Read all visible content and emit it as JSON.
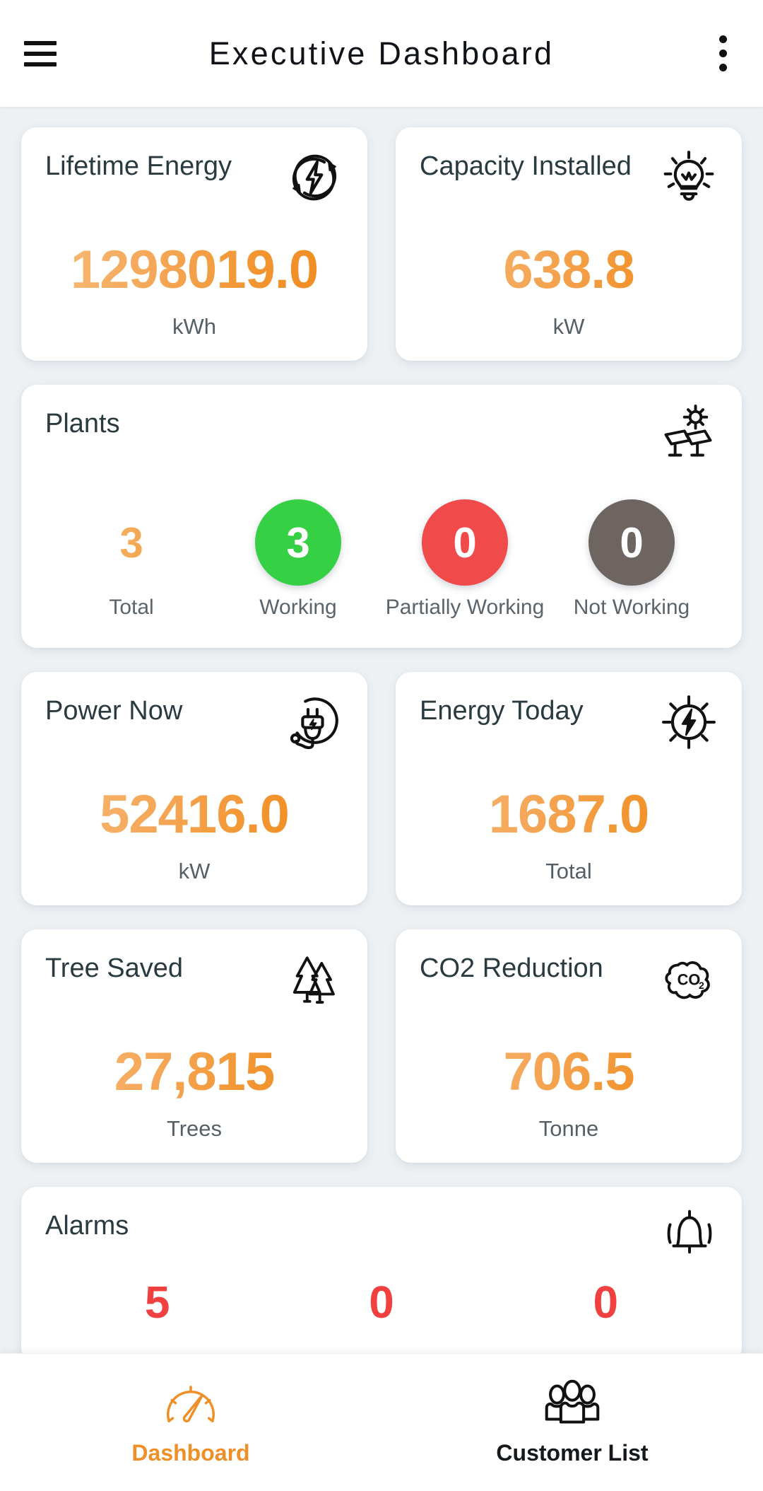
{
  "header": {
    "title": "Executive Dashboard",
    "menu_icon": "hamburger-menu-icon",
    "overflow_icon": "kebab-menu-icon"
  },
  "colors": {
    "background": "#edf1f4",
    "card": "#ffffff",
    "accent_orange": "#ef8f28",
    "value_gradient_start": "#f6bb76",
    "value_gradient_end": "#f08a1c",
    "title_text": "#2a3a41",
    "unit_text": "#555f66",
    "status_working": "#35d043",
    "status_partial": "#f04a4a",
    "status_not_working": "#6e6460",
    "alarm_red": "#f04040"
  },
  "cards": {
    "lifetime_energy": {
      "title": "Lifetime Energy",
      "value": "1298019.0",
      "unit": "kWh",
      "icon": "energy-bolt-cycle-icon"
    },
    "capacity_installed": {
      "title": "Capacity Installed",
      "value": "638.8",
      "unit": "kW",
      "icon": "lightbulb-icon"
    },
    "plants": {
      "title": "Plants",
      "icon": "solar-panel-sun-icon",
      "stats": [
        {
          "value": "3",
          "label": "Total",
          "style": "plain"
        },
        {
          "value": "3",
          "label": "Working",
          "style": "green"
        },
        {
          "value": "0",
          "label": "Partially Working",
          "style": "red"
        },
        {
          "value": "0",
          "label": "Not Working",
          "style": "gray"
        }
      ]
    },
    "power_now": {
      "title": "Power Now",
      "value": "52416.0",
      "unit": "kW",
      "icon": "power-plug-icon"
    },
    "energy_today": {
      "title": "Energy Today",
      "value": "1687.0",
      "unit": "Total",
      "icon": "sun-bolt-icon"
    },
    "tree_saved": {
      "title": "Tree Saved",
      "value": "27,815",
      "unit": "Trees",
      "icon": "pine-trees-icon"
    },
    "co2_reduction": {
      "title": "CO2 Reduction",
      "value": "706.5",
      "unit": "Tonne",
      "icon": "co2-cloud-icon"
    },
    "alarms": {
      "title": "Alarms",
      "icon": "bell-icon",
      "values": [
        "5",
        "0",
        "0"
      ]
    }
  },
  "bottom_nav": {
    "items": [
      {
        "label": "Dashboard",
        "icon": "speedometer-icon",
        "active": true
      },
      {
        "label": "Customer List",
        "icon": "people-group-icon",
        "active": false
      }
    ]
  }
}
